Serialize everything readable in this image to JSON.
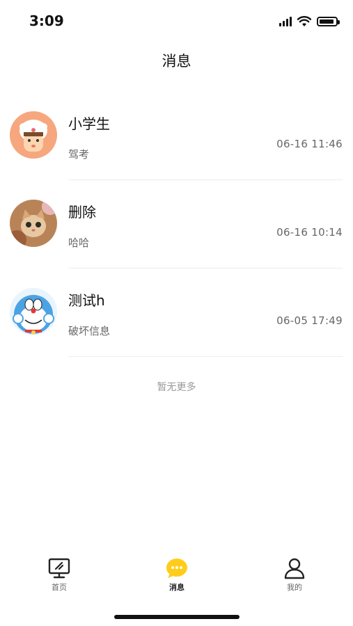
{
  "status_bar": {
    "time": "3:09"
  },
  "header": {
    "title": "消息"
  },
  "messages": [
    {
      "name": "小学生",
      "preview": "驾考",
      "time": "06-16 11:46",
      "avatar": "cartoon-girl-avatar"
    },
    {
      "name": "删除",
      "preview": "哈哈",
      "time": "06-16 10:14",
      "avatar": "cat-photo-avatar"
    },
    {
      "name": "测试h",
      "preview": "破坏信息",
      "time": "06-05 17:49",
      "avatar": "doraemon-avatar"
    }
  ],
  "list_footer": "暂无更多",
  "tab_bar": {
    "tabs": [
      {
        "label": "首页",
        "icon": "monitor-icon",
        "active": false
      },
      {
        "label": "消息",
        "icon": "chat-bubble-icon",
        "active": true
      },
      {
        "label": "我的",
        "icon": "user-icon",
        "active": false
      }
    ]
  },
  "colors": {
    "accent": "#FFCC1A",
    "text_primary": "#111111",
    "text_secondary": "#666666",
    "divider": "#EDEDED"
  }
}
